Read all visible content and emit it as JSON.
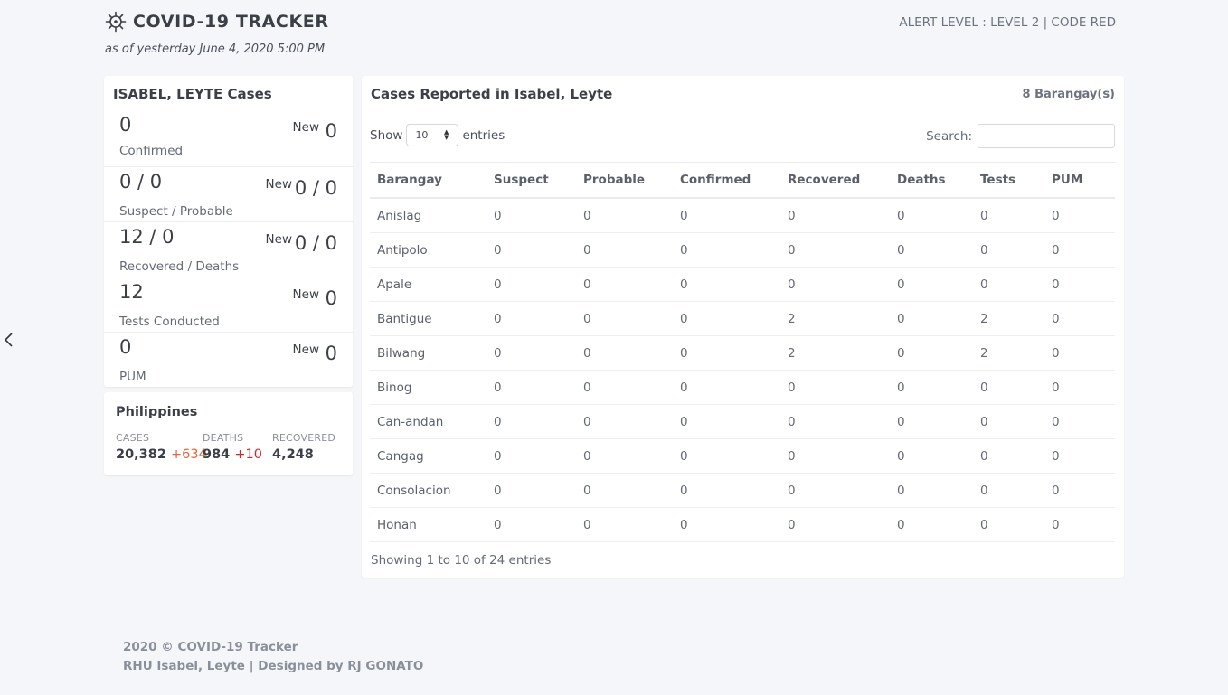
{
  "header": {
    "title": "COVID-19 TRACKER",
    "subtitle": "as of yesterday June 4, 2020 5:00 PM",
    "alert": "ALERT LEVEL : LEVEL 2 | CODE RED",
    "icon": "virus-icon"
  },
  "local": {
    "title": "ISABEL, LEYTE Cases",
    "new_label": "New",
    "stats": [
      {
        "value": "0",
        "label": "Confirmed",
        "new": "0"
      },
      {
        "value": "0 / 0",
        "label": "Suspect / Probable",
        "new": "0 / 0"
      },
      {
        "value": "12 / 0",
        "label": "Recovered / Deaths",
        "new": "0 / 0"
      },
      {
        "value": "12",
        "label": "Tests Conducted",
        "new": "0"
      },
      {
        "value": "0",
        "label": "PUM",
        "new": "0"
      }
    ]
  },
  "national": {
    "title": "Philippines",
    "cases_label": "CASES",
    "cases": "20,382",
    "cases_new": "+634",
    "deaths_label": "DEATHS",
    "deaths": "984",
    "deaths_new": "+10",
    "recovered_label": "RECOVERED",
    "recovered": "4,248"
  },
  "table": {
    "title": "Cases Reported in Isabel, Leyte",
    "count": "8 Barangay(s)",
    "show_label": "Show",
    "entries_label": "entries",
    "page_length": "10",
    "search_label": "Search:",
    "search_value": "",
    "columns": [
      "Barangay",
      "Suspect",
      "Probable",
      "Confirmed",
      "Recovered",
      "Deaths",
      "Tests",
      "PUM"
    ],
    "rows": [
      [
        "Anislag",
        "0",
        "0",
        "0",
        "0",
        "0",
        "0",
        "0"
      ],
      [
        "Antipolo",
        "0",
        "0",
        "0",
        "0",
        "0",
        "0",
        "0"
      ],
      [
        "Apale",
        "0",
        "0",
        "0",
        "0",
        "0",
        "0",
        "0"
      ],
      [
        "Bantigue",
        "0",
        "0",
        "0",
        "2",
        "0",
        "2",
        "0"
      ],
      [
        "Bilwang",
        "0",
        "0",
        "0",
        "2",
        "0",
        "2",
        "0"
      ],
      [
        "Binog",
        "0",
        "0",
        "0",
        "0",
        "0",
        "0",
        "0"
      ],
      [
        "Can-andan",
        "0",
        "0",
        "0",
        "0",
        "0",
        "0",
        "0"
      ],
      [
        "Cangag",
        "0",
        "0",
        "0",
        "0",
        "0",
        "0",
        "0"
      ],
      [
        "Consolacion",
        "0",
        "0",
        "0",
        "0",
        "0",
        "0",
        "0"
      ],
      [
        "Honan",
        "0",
        "0",
        "0",
        "0",
        "0",
        "0",
        "0"
      ]
    ],
    "info": "Showing 1 to 10 of 24 entries"
  },
  "footer": {
    "line1": "2020 © COVID-19 Tracker",
    "line2": "RHU Isabel, Leyte | Designed by RJ GONATO"
  },
  "nav": {
    "prev_icon": "chevron-left-icon"
  }
}
